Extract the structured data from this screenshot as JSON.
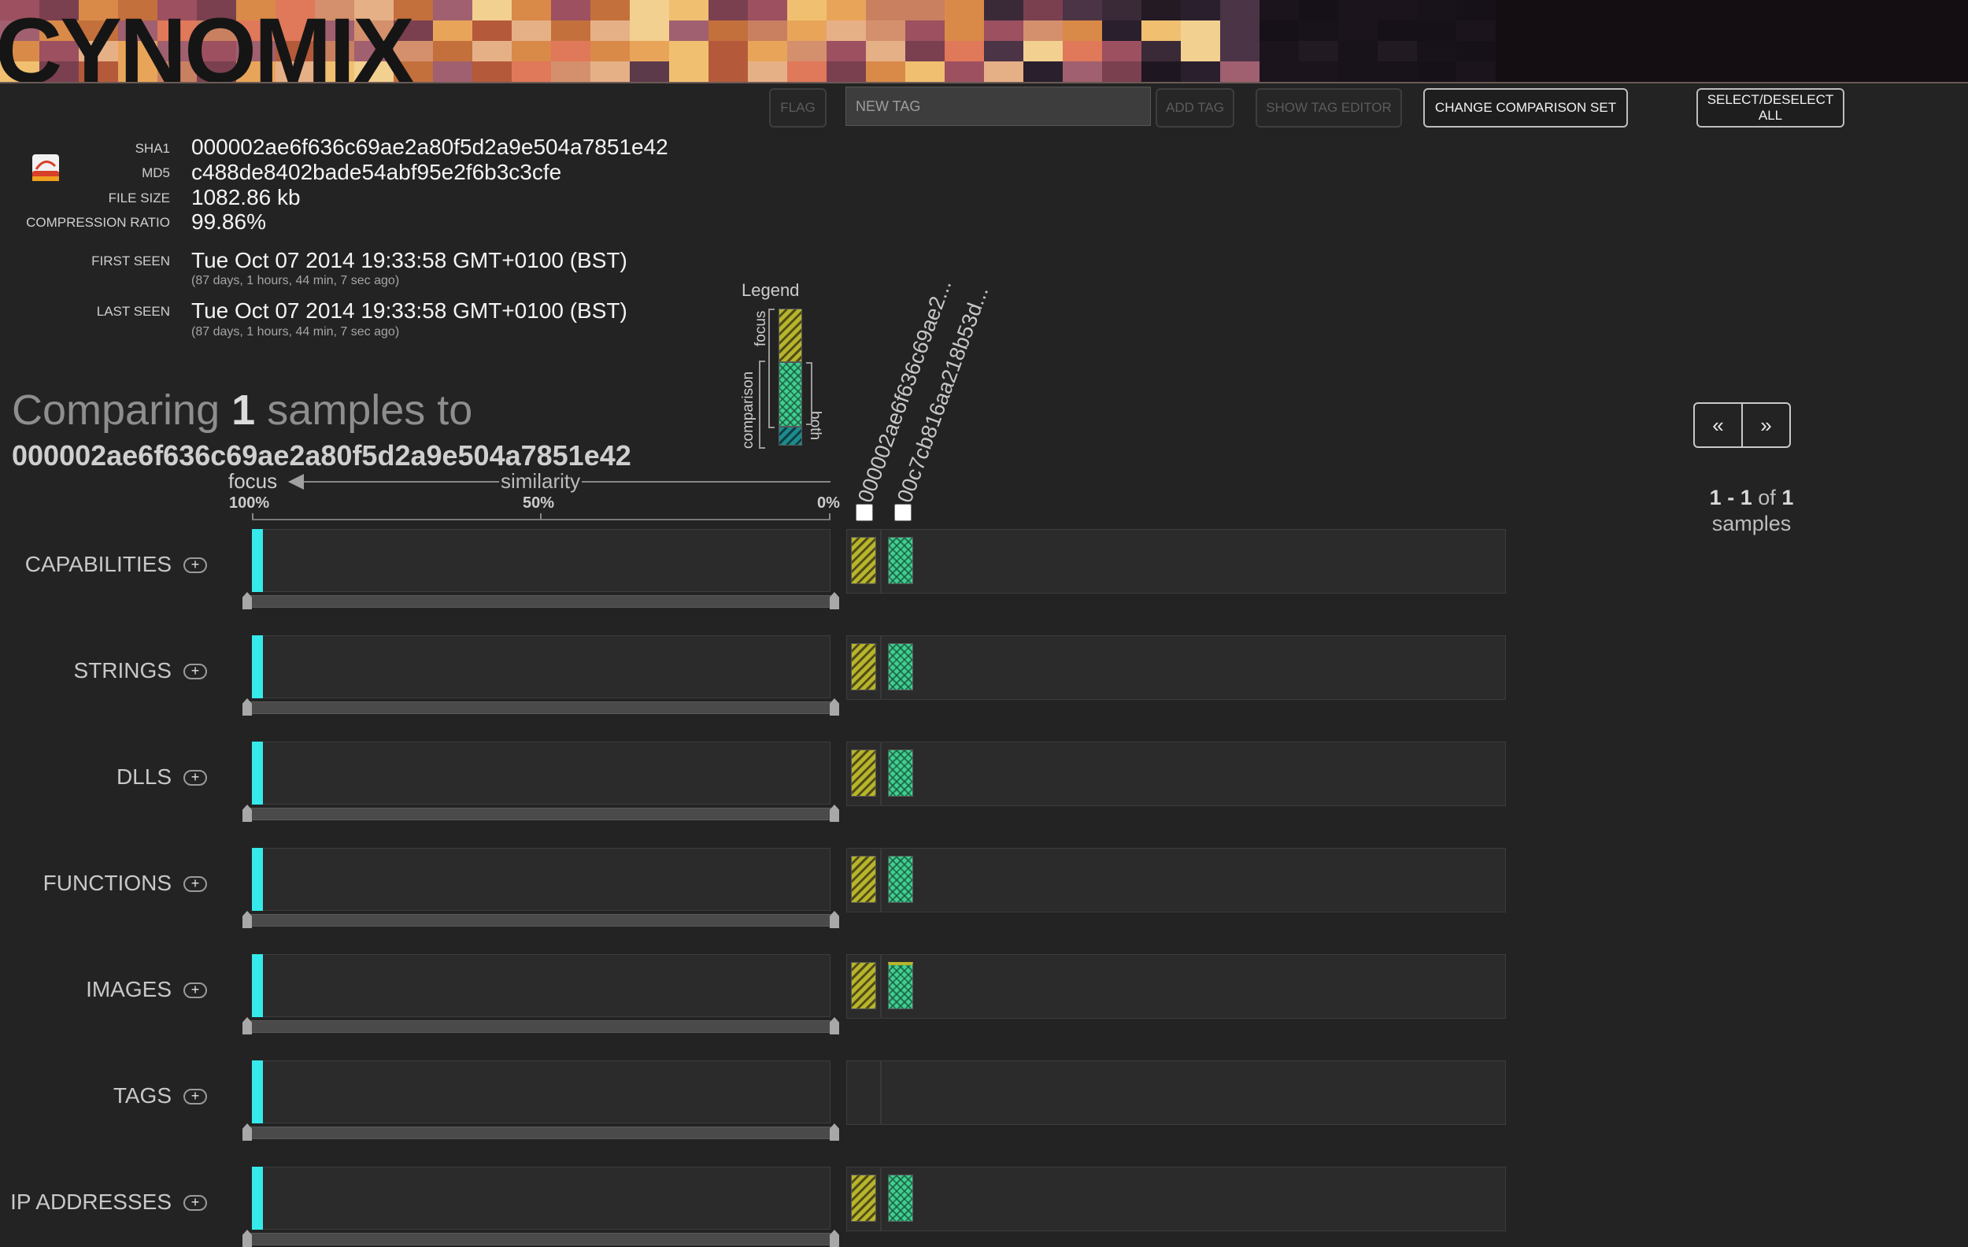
{
  "app": {
    "logo_text": "CYNOMIX"
  },
  "toolbar": {
    "flag_label": "FLAG",
    "new_tag_placeholder": "NEW TAG",
    "add_tag_label": "ADD TAG",
    "show_tag_editor_label": "SHOW TAG EDITOR",
    "change_comparison_set_label": "CHANGE COMPARISON SET",
    "select_deselect_label": "SELECT/DESELECT ALL"
  },
  "file": {
    "icon": "pdf-file-icon",
    "sha1_label": "SHA1",
    "sha1": "000002ae6f636c69ae2a80f5d2a9e504a7851e42",
    "md5_label": "MD5",
    "md5": "c488de8402bade54abf95e2f6b3c3cfe",
    "file_size_label": "FILE SIZE",
    "file_size": "1082.86 kb",
    "compression_label": "COMPRESSION RATIO",
    "compression_ratio": "99.86%",
    "first_seen_label": "FIRST SEEN",
    "first_seen": "Tue Oct 07 2014 19:33:58 GMT+0100 (BST)",
    "first_seen_ago": "(87 days, 1 hours, 44 min, 7 sec ago)",
    "last_seen_label": "LAST SEEN",
    "last_seen": "Tue Oct 07 2014 19:33:58 GMT+0100 (BST)",
    "last_seen_ago": "(87 days, 1 hours, 44 min, 7 sec ago)"
  },
  "comparison": {
    "prefix": "Comparing",
    "count": "1",
    "suffix": "samples to",
    "focus_hash": "000002ae6f636c69ae2a80f5d2a9e504a7851e42"
  },
  "legend": {
    "title": "Legend",
    "focus_label": "focus",
    "comparison_label": "comparison",
    "both_label": "both",
    "colors": {
      "focus": "#b8b42c",
      "comparison": "#3fcf8e",
      "both": "#1d8b8d"
    }
  },
  "similarity_axis": {
    "focus_label": "focus",
    "similarity_label": "similarity",
    "tick_labels": [
      "100%",
      "50%",
      "0%"
    ]
  },
  "sample_columns": [
    {
      "label": "000002ae6f636c69ae2...",
      "checked": false
    },
    {
      "label": "00c7cb816aa218b53d...",
      "checked": false
    }
  ],
  "categories": [
    {
      "label": "CAPABILITIES",
      "expand": "+",
      "similarity_focus": 1.0,
      "focus_bar": true,
      "comparison_bar": true,
      "comparison_top_yellow": false
    },
    {
      "label": "STRINGS",
      "expand": "+",
      "similarity_focus": 1.0,
      "focus_bar": true,
      "comparison_bar": true,
      "comparison_top_yellow": false
    },
    {
      "label": "DLLS",
      "expand": "+",
      "similarity_focus": 1.0,
      "focus_bar": true,
      "comparison_bar": true,
      "comparison_top_yellow": false
    },
    {
      "label": "FUNCTIONS",
      "expand": "+",
      "similarity_focus": 1.0,
      "focus_bar": true,
      "comparison_bar": true,
      "comparison_top_yellow": false
    },
    {
      "label": "IMAGES",
      "expand": "+",
      "similarity_focus": 1.0,
      "focus_bar": true,
      "comparison_bar": true,
      "comparison_top_yellow": true
    },
    {
      "label": "TAGS",
      "expand": "+",
      "similarity_focus": 1.0,
      "focus_bar": false,
      "comparison_bar": false,
      "comparison_top_yellow": false
    },
    {
      "label": "IP ADDRESSES",
      "expand": "+",
      "similarity_focus": 1.0,
      "focus_bar": true,
      "comparison_bar": true,
      "comparison_top_yellow": false
    }
  ],
  "pagination": {
    "prev_label": "«",
    "next_label": "»",
    "range_start": "1",
    "range_sep": "-",
    "range_end": "1",
    "of_label": "of",
    "total": "1",
    "unit_label": "samples"
  }
}
